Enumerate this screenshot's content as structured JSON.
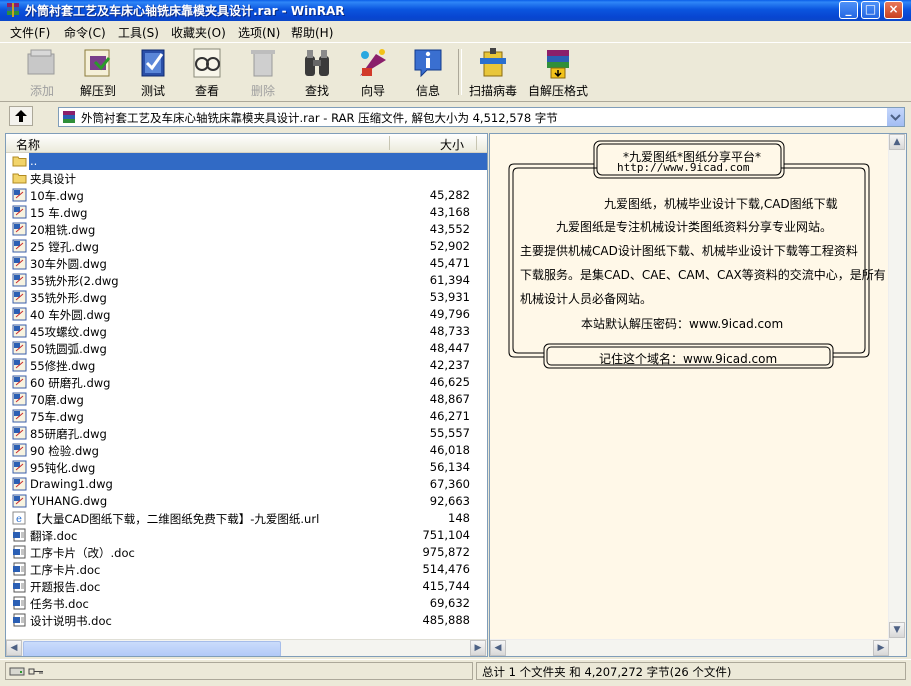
{
  "window": {
    "title": "外筒衬套工艺及车床心轴铣床靠模夹具设计.rar - WinRAR",
    "controls": {
      "minimize": "_",
      "maximize": "□",
      "close": "×"
    }
  },
  "menu": [
    {
      "label": "文件(F)"
    },
    {
      "label": "命令(C)"
    },
    {
      "label": "工具(S)"
    },
    {
      "label": "收藏夹(O)"
    },
    {
      "label": "选项(N)"
    },
    {
      "label": "帮助(H)"
    }
  ],
  "toolbar": [
    {
      "label": "添加",
      "icon": "add-icon",
      "enabled": false
    },
    {
      "label": "解压到",
      "icon": "extract-to-icon",
      "enabled": true
    },
    {
      "label": "测试",
      "icon": "test-icon",
      "enabled": true
    },
    {
      "label": "查看",
      "icon": "view-icon",
      "enabled": true
    },
    {
      "label": "删除",
      "icon": "delete-icon",
      "enabled": false
    },
    {
      "label": "查找",
      "icon": "find-icon",
      "enabled": true
    },
    {
      "label": "向导",
      "icon": "wizard-icon",
      "enabled": true
    },
    {
      "label": "信息",
      "icon": "info-icon",
      "enabled": true
    },
    {
      "label": "扫描病毒",
      "icon": "virus-scan-icon",
      "enabled": true
    },
    {
      "label": "自解压格式",
      "icon": "sfx-icon",
      "enabled": true
    }
  ],
  "address": {
    "text": "外筒衬套工艺及车床心轴铣床靠模夹具设计.rar - RAR 压缩文件, 解包大小为 4,512,578 字节"
  },
  "list": {
    "columns": {
      "name": "名称",
      "size": "大小"
    },
    "rows": [
      {
        "name": "..",
        "size": "",
        "type": "folder",
        "selected": true
      },
      {
        "name": "夹具设计",
        "size": "",
        "type": "folder"
      },
      {
        "name": "10车.dwg",
        "size": "45,282",
        "type": "dwg"
      },
      {
        "name": "15 车.dwg",
        "size": "43,168",
        "type": "dwg"
      },
      {
        "name": "20粗铣.dwg",
        "size": "43,552",
        "type": "dwg"
      },
      {
        "name": "25 镗孔.dwg",
        "size": "52,902",
        "type": "dwg"
      },
      {
        "name": "30车外圆.dwg",
        "size": "45,471",
        "type": "dwg"
      },
      {
        "name": "35铣外形(2.dwg",
        "size": "61,394",
        "type": "dwg"
      },
      {
        "name": "35铣外形.dwg",
        "size": "53,931",
        "type": "dwg"
      },
      {
        "name": "40 车外圆.dwg",
        "size": "49,796",
        "type": "dwg"
      },
      {
        "name": "45攻螺纹.dwg",
        "size": "48,733",
        "type": "dwg"
      },
      {
        "name": "50铣圆弧.dwg",
        "size": "48,447",
        "type": "dwg"
      },
      {
        "name": "55修挫.dwg",
        "size": "42,237",
        "type": "dwg"
      },
      {
        "name": "60 研磨孔.dwg",
        "size": "46,625",
        "type": "dwg"
      },
      {
        "name": "70磨.dwg",
        "size": "48,867",
        "type": "dwg"
      },
      {
        "name": "75车.dwg",
        "size": "46,271",
        "type": "dwg"
      },
      {
        "name": "85研磨孔.dwg",
        "size": "55,557",
        "type": "dwg"
      },
      {
        "name": "90 检验.dwg",
        "size": "46,018",
        "type": "dwg"
      },
      {
        "name": "95钝化.dwg",
        "size": "56,134",
        "type": "dwg"
      },
      {
        "name": "Drawing1.dwg",
        "size": "67,360",
        "type": "dwg"
      },
      {
        "name": "YUHANG.dwg",
        "size": "92,663",
        "type": "dwg"
      },
      {
        "name": "【大量CAD图纸下载，二维图纸免费下载】-九爱图纸.url",
        "size": "148",
        "type": "url"
      },
      {
        "name": "翻译.doc",
        "size": "751,104",
        "type": "doc"
      },
      {
        "name": "工序卡片（改）.doc",
        "size": "975,872",
        "type": "doc"
      },
      {
        "name": "工序卡片.doc",
        "size": "514,476",
        "type": "doc"
      },
      {
        "name": "开题报告.doc",
        "size": "415,744",
        "type": "doc"
      },
      {
        "name": "任务书.doc",
        "size": "69,632",
        "type": "doc"
      },
      {
        "name": "设计说明书.doc",
        "size": "485,888",
        "type": "doc"
      }
    ]
  },
  "comment": {
    "header_title": "*九爱图纸*图纸分享平台*",
    "header_url": "http://www.9icad.com",
    "line1": "九爱图纸，机械毕业设计下载,CAD图纸下载",
    "line2": "九爱图纸是专注机械设计类图纸资料分享专业网站。",
    "line3": "主要提供机械CAD设计图纸下载、机械毕业设计下载等工程资料",
    "line4": "下载服务。是集CAD、CAE、CAM、CAX等资料的交流中心，是所有",
    "line5": "机械设计人员必备网站。",
    "line6": "本站默认解压密码：www.9icad.com",
    "footer": "记住这个域名：www.9icad.com"
  },
  "status": {
    "right": "总计 1 个文件夹 和 4,207,272 字节(26 个文件)"
  }
}
